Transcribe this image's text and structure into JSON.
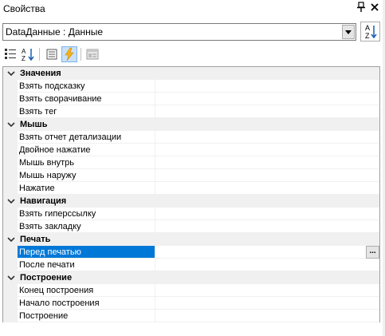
{
  "window": {
    "title": "Свойства",
    "pin_icon": "pin-icon",
    "close_icon": "close-icon"
  },
  "selector": {
    "value": "DataДанные : Данные",
    "sort_button_icon": "az-sort-icon"
  },
  "toolbar": {
    "buttons": [
      "categorized-icon",
      "alphabetical-icon",
      "properties-icon",
      "events-icon",
      "property-pages-icon"
    ],
    "active": "events-icon"
  },
  "colors": {
    "selection": "#0078d7",
    "category_bg": "#f0f0f0",
    "events_accent": "#f6b21a"
  },
  "grid": {
    "categories": [
      {
        "label": "Значения",
        "items": [
          "Взять подсказку",
          "Взять сворачивание",
          "Взять тег"
        ]
      },
      {
        "label": "Мышь",
        "items": [
          "Взять отчет детализации",
          "Двойное нажатие",
          "Мышь внутрь",
          "Мышь наружу",
          "Нажатие"
        ]
      },
      {
        "label": "Навигация",
        "items": [
          "Взять гиперссылку",
          "Взять закладку"
        ]
      },
      {
        "label": "Печать",
        "items": [
          "Перед печатью",
          "После печати"
        ]
      },
      {
        "label": "Построение",
        "items": [
          "Конец построения",
          "Начало построения",
          "Построение"
        ]
      }
    ],
    "selected_item": "Перед печатью",
    "ellipsis_label": "..."
  }
}
